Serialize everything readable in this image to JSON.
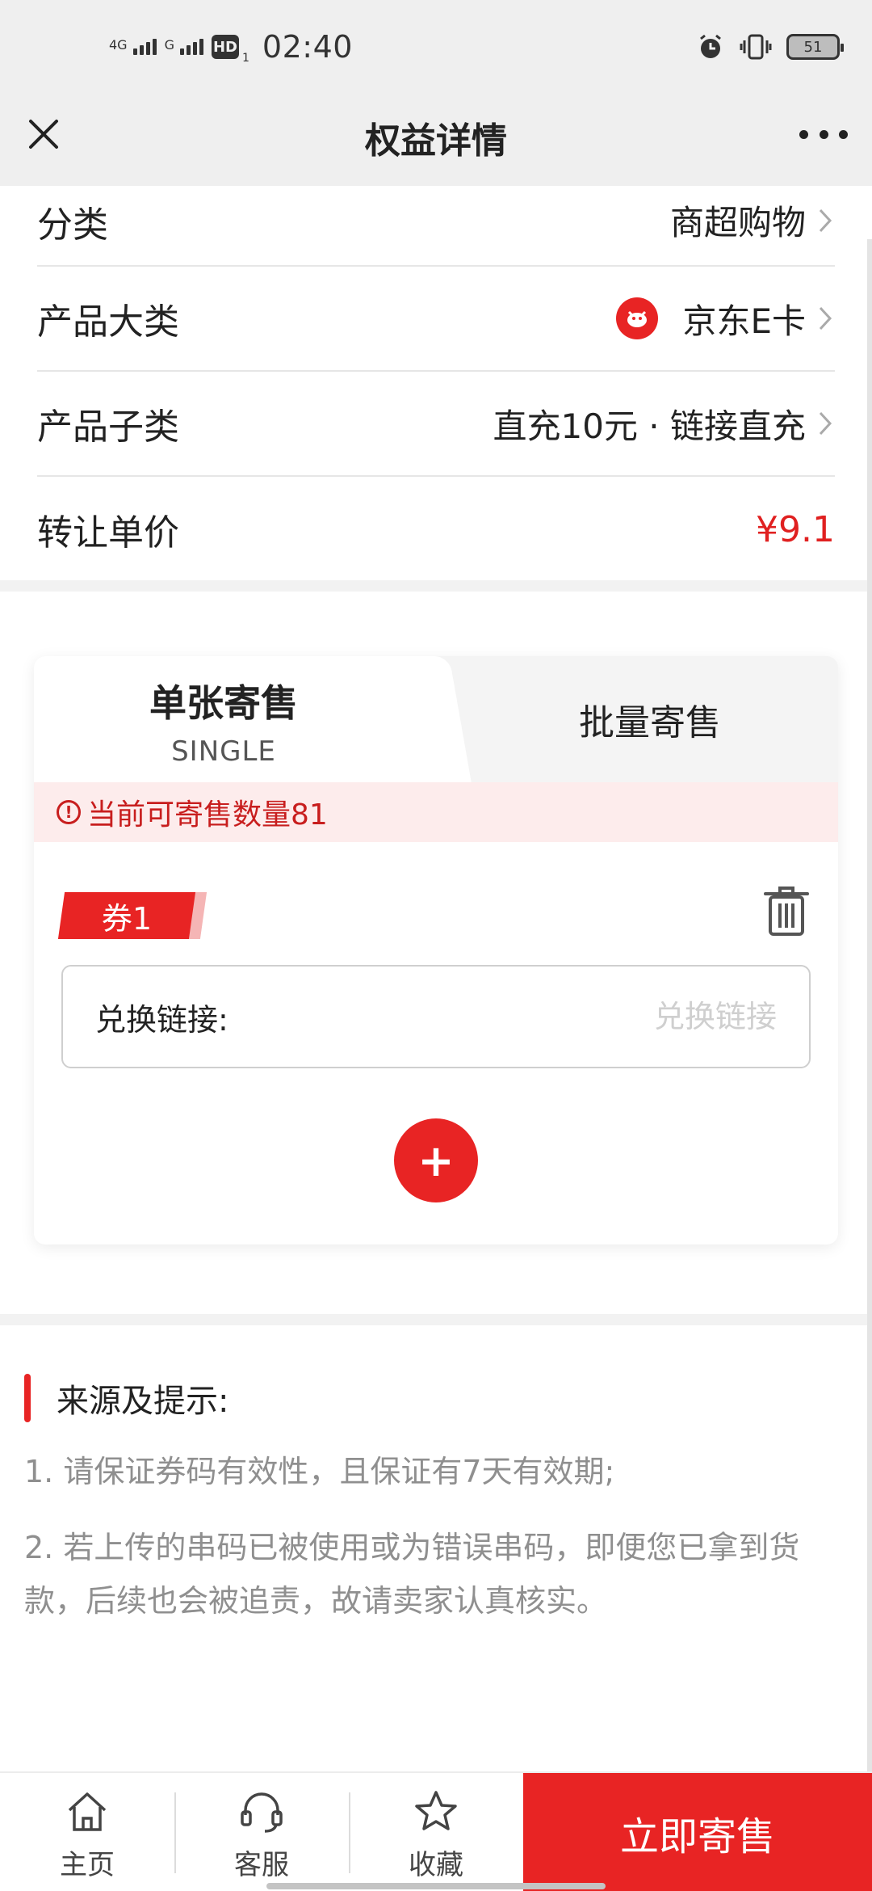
{
  "status_bar": {
    "net1": "4G",
    "net2": "G",
    "hd": "HD",
    "hd_sub": "1",
    "time": "02:40",
    "battery": "51"
  },
  "nav": {
    "title": "权益详情"
  },
  "rows": [
    {
      "key": "分类",
      "value": "商超购物"
    },
    {
      "key": "产品大类",
      "value": "京东E卡"
    },
    {
      "key": "产品子类",
      "value": "直充10元 · 链接直充"
    },
    {
      "key": "转让单价",
      "value": "¥9.1"
    }
  ],
  "card": {
    "tab_single_title": "单张寄售",
    "tab_single_sub": "SINGLE",
    "tab_batch": "批量寄售",
    "notice": "当前可寄售数量81",
    "coupon_label": "券1",
    "input_label": "兑换链接:",
    "input_placeholder": "兑换链接",
    "input_value": "",
    "add_label": "+"
  },
  "tips": {
    "title": "来源及提示:",
    "items": [
      "1. 请保证券码有效性，且保证有7天有效期;",
      "2. 若上传的串码已被使用或为错误串码，即便您已拿到货款，后续也会被追责，故请卖家认真核实。"
    ]
  },
  "bottom_bar": {
    "home": "主页",
    "service": "客服",
    "favorite": "收藏",
    "sell_now": "立即寄售"
  },
  "colors": {
    "accent": "#e82424",
    "price": "#e02020",
    "notice_bg": "#fdecec"
  }
}
